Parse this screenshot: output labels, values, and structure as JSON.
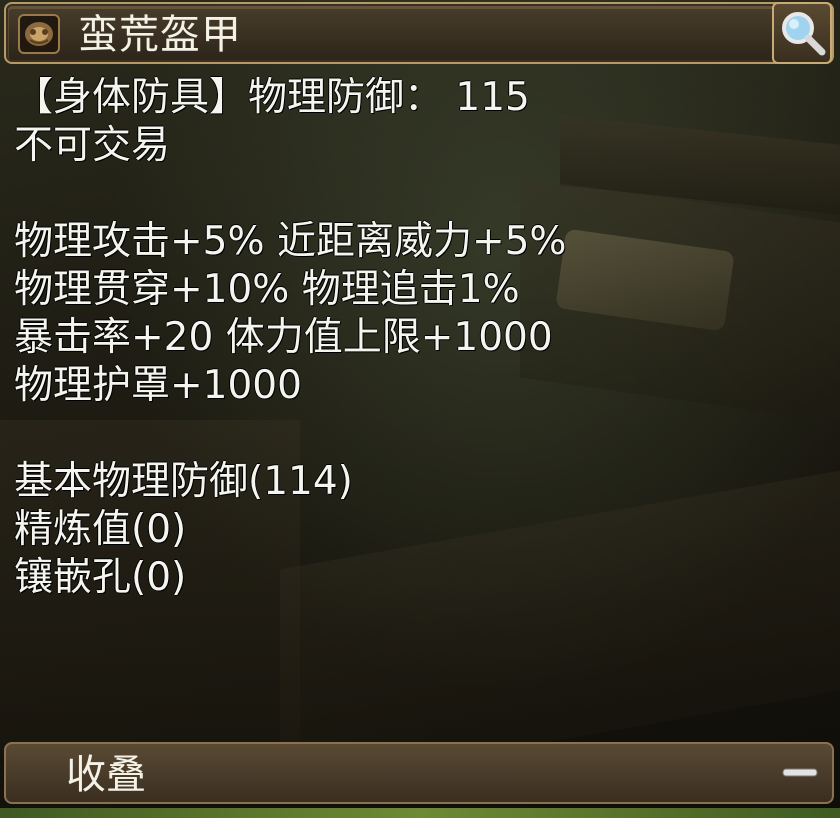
{
  "tooltip": {
    "title": "蛮荒盔甲",
    "lines": {
      "slot_defense": "【身体防具】物理防御： 115",
      "trade": "不可交易",
      "stat1": "物理攻击+5% 近距离威力+5%",
      "stat2": "物理贯穿+10% 物理追击1%",
      "stat3": "暴击率+20 体力值上限+1000",
      "stat4": "物理护罩+1000",
      "base_defense": "基本物理防御(114)",
      "refine": "精炼值(0)",
      "sockets": "镶嵌孔(0)"
    },
    "footer_label": "收叠",
    "icons": {
      "item": "armor-item-icon",
      "search": "magnifier-icon",
      "collapse": "minus-icon"
    }
  },
  "colors": {
    "text": "#f5f5f0",
    "frame_border": "#b59a66",
    "panel_dark": "#2c241a",
    "footer_bar": "#4a3c2a"
  }
}
